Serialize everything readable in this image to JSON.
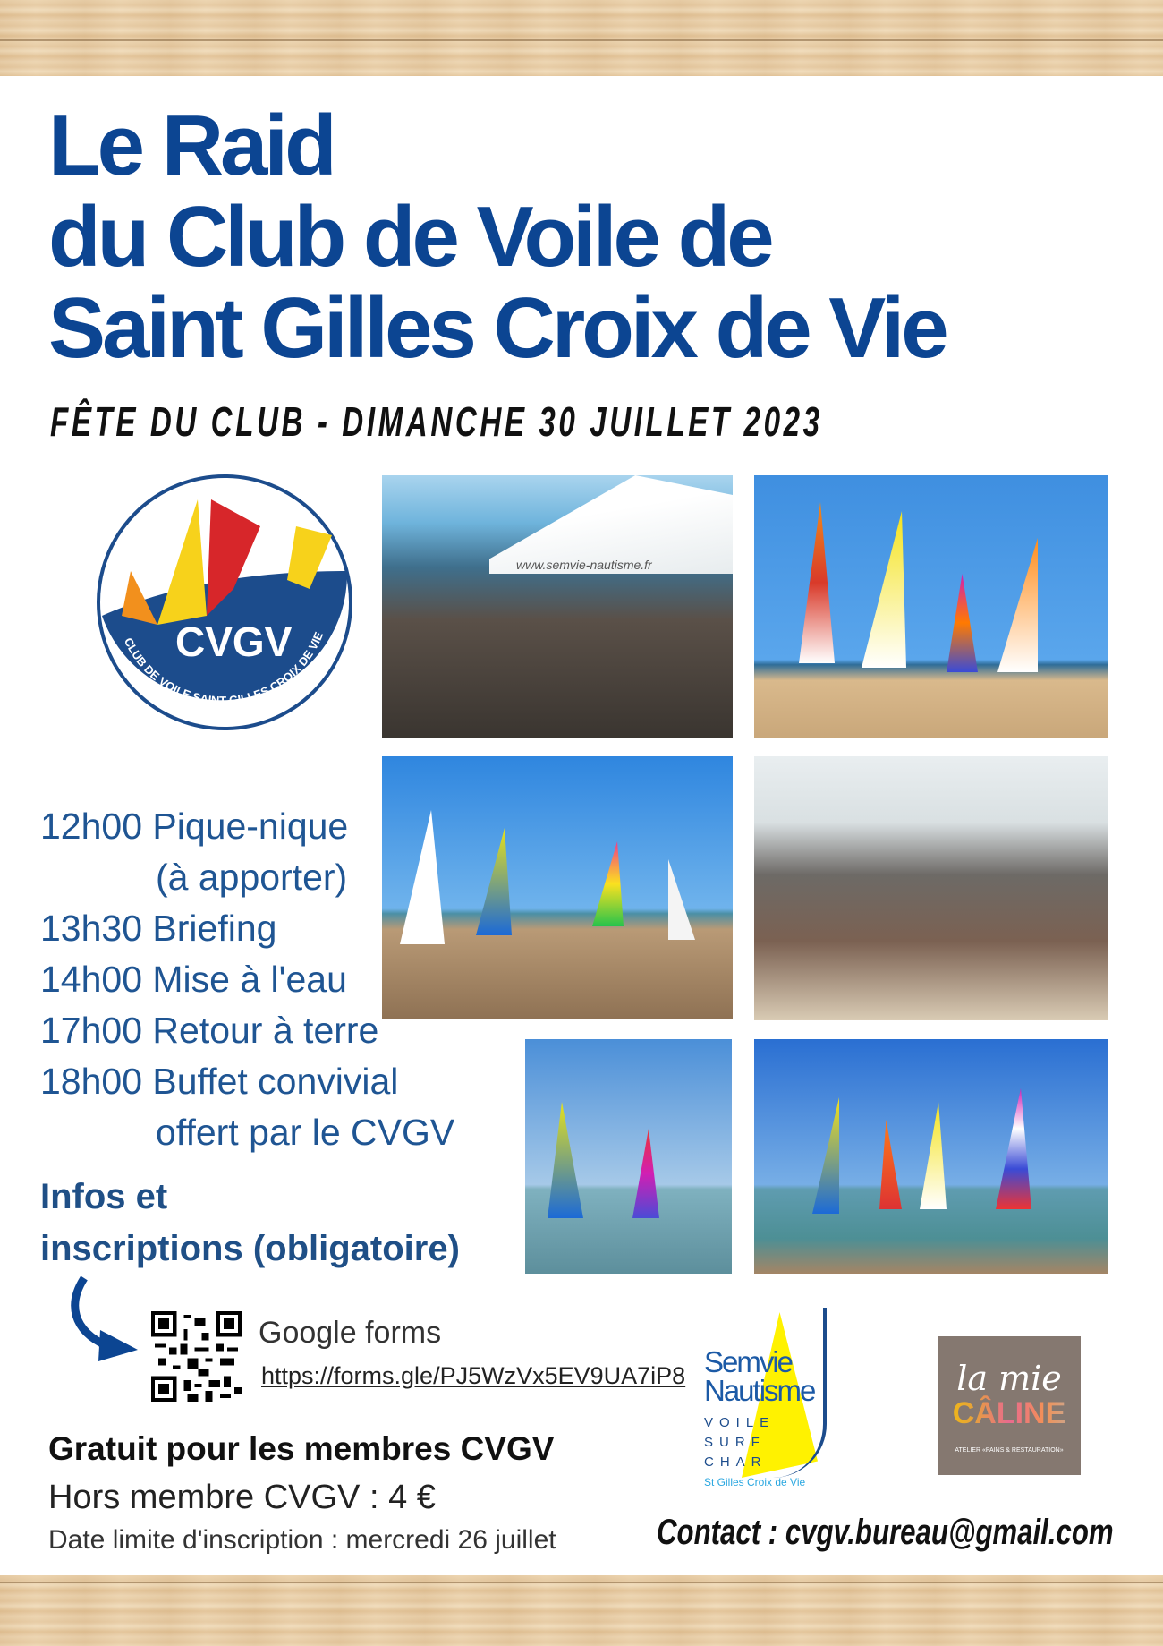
{
  "title": {
    "line1": "Le Raid",
    "line2": "du Club de Voile de",
    "line3": "Saint Gilles Croix de Vie"
  },
  "subtitle": "FÊTE DU CLUB - DIMANCHE 30 JUILLET 2023",
  "logo": {
    "name": "CVGV",
    "ring_text": "CLUB DE VOILE SAINT GILLES CROIX DE VIE"
  },
  "photos": [
    {
      "caption_in_image": "www.semvie-nautisme.fr"
    },
    {},
    {},
    {},
    {},
    {}
  ],
  "schedule": [
    {
      "text": "12h00 Pique-nique"
    },
    {
      "text": "(à apporter)",
      "indent": true
    },
    {
      "text": "13h30 Briefing"
    },
    {
      "text": "14h00 Mise à l'eau"
    },
    {
      "text": "17h00 Retour à terre"
    },
    {
      "text": "18h00 Buffet convivial"
    },
    {
      "text": "offert par le CVGV",
      "indent": true
    }
  ],
  "infos": {
    "line1": "Infos et",
    "line2": "inscriptions (obligatoire)"
  },
  "form": {
    "label": "Google forms",
    "link": "https://forms.gle/PJ5WzVx5EV9UA7iP8"
  },
  "pricing": {
    "members": "Gratuit pour les membres CVGV",
    "non_members": "Hors membre CVGV : 4 €",
    "deadline": "Date limite d'inscription : mercredi 26 juillet"
  },
  "sponsors": {
    "semvie": {
      "line1": "Semvie",
      "line2": "Nautisme",
      "activities": [
        "VOILE",
        "SURF",
        "CHAR"
      ],
      "place": "St Gilles Croix de Vie"
    },
    "lamiecaline": {
      "line1": "la mie",
      "line2": "CÂLINE",
      "tagline": "ATELIER «PAINS & RESTAURATION»"
    }
  },
  "contact": "Contact : cvgv.bureau@gmail.com",
  "colors": {
    "title": "#0c4592",
    "schedule": "#1f5593",
    "wood": "#ecd3ad"
  }
}
